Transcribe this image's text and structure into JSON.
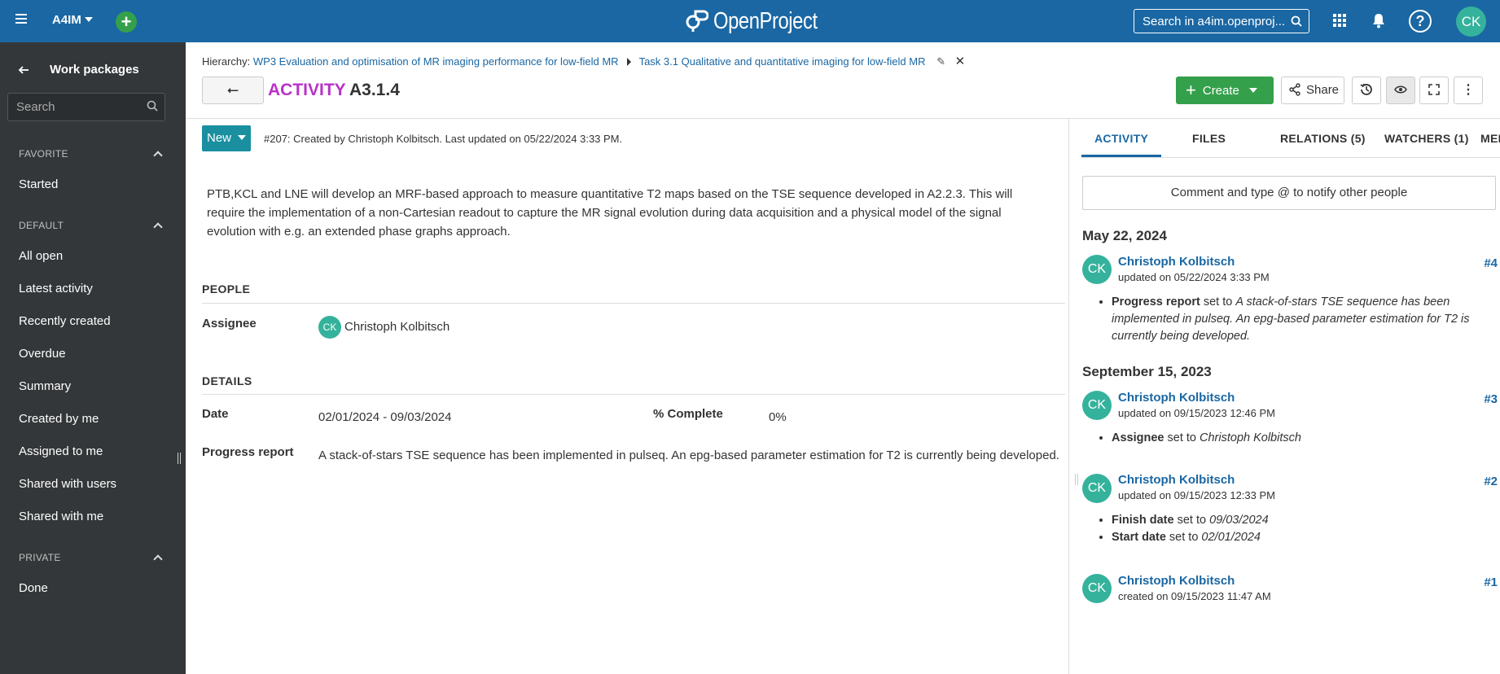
{
  "header": {
    "project": "A4IM",
    "logo_text": "OpenProject",
    "search_placeholder": "Search in a4im.openproj...",
    "avatar_initials": "CK"
  },
  "sidebar": {
    "title": "Work packages",
    "search_placeholder": "Search",
    "sections": [
      {
        "label": "FAVORITE",
        "items": [
          "Started"
        ]
      },
      {
        "label": "DEFAULT",
        "items": [
          "All open",
          "Latest activity",
          "Recently created",
          "Overdue",
          "Summary",
          "Created by me",
          "Assigned to me",
          "Shared with users",
          "Shared with me"
        ]
      },
      {
        "label": "PRIVATE",
        "items": [
          "Done"
        ]
      }
    ]
  },
  "breadcrumb": {
    "prefix": "Hierarchy:",
    "parent": "WP3 Evaluation and optimisation of MR imaging performance for low-field MR",
    "current": "Task 3.1 Qualitative and quantitative imaging for low-field MR"
  },
  "workpackage": {
    "type": "ACTIVITY",
    "subject": "A3.1.4",
    "status": "New",
    "created_info": "#207: Created by Christoph Kolbitsch. Last updated on 05/22/2024 3:33 PM.",
    "description": "PTB,KCL and LNE will develop an MRF-based approach to measure quantitative T2 maps based on the TSE sequence developed in A2.2.3. This will require the implementation of a non-Cartesian readout to capture the MR signal evolution during data acquisition and a physical model of the signal evolution with e.g. an extended phase graphs approach.",
    "people_heading": "PEOPLE",
    "assignee_label": "Assignee",
    "assignee_initials": "CK",
    "assignee_name": "Christoph Kolbitsch",
    "details_heading": "DETAILS",
    "date_label": "Date",
    "date_value": "02/01/2024 - 09/03/2024",
    "complete_label": "% Complete",
    "complete_value": "0%",
    "progress_label": "Progress report",
    "progress_value": "A stack-of-stars TSE sequence has been implemented in pulseq. An epg-based parameter estimation for T2 is currently being developed."
  },
  "toolbar": {
    "create_label": "Create",
    "share_label": "Share"
  },
  "activity": {
    "tabs": [
      "ACTIVITY",
      "FILES",
      "RELATIONS (5)",
      "WATCHERS (1)",
      "MEETINGS"
    ],
    "comment_placeholder": "Comment and type @ to notify other people",
    "days": [
      "May 22, 2024",
      "September 15, 2023"
    ],
    "entries": [
      {
        "initials": "CK",
        "user": "Christoph Kolbitsch",
        "meta": "updated on 05/22/2024 3:33 PM",
        "num": "#4",
        "field": "Progress report",
        "set_to": "set to",
        "value": "A stack-of-stars TSE sequence has been implemented in pulseq. An epg-based parameter estimation for T2 is currently being developed."
      },
      {
        "initials": "CK",
        "user": "Christoph Kolbitsch",
        "meta": "updated on 09/15/2023 12:46 PM",
        "num": "#3",
        "field": "Assignee",
        "set_to": "set to",
        "value": "Christoph Kolbitsch"
      },
      {
        "initials": "CK",
        "user": "Christoph Kolbitsch",
        "meta": "updated on 09/15/2023 12:33 PM",
        "num": "#2",
        "field": "Finish date",
        "set_to": "set to",
        "value": "09/03/2024",
        "field2": "Start date",
        "set_to2": "set to",
        "value2": "02/01/2024"
      },
      {
        "initials": "CK",
        "user": "Christoph Kolbitsch",
        "meta": "created on 09/15/2023 11:47 AM",
        "num": "#1"
      }
    ]
  },
  "colors": {
    "header_blue": "#1a67a3",
    "sidebar_dark": "#333739",
    "create_green": "#35a04b",
    "status_teal": "#1a8fa0",
    "type_purple": "#b832c8",
    "avatar_teal": "#35b29b"
  }
}
